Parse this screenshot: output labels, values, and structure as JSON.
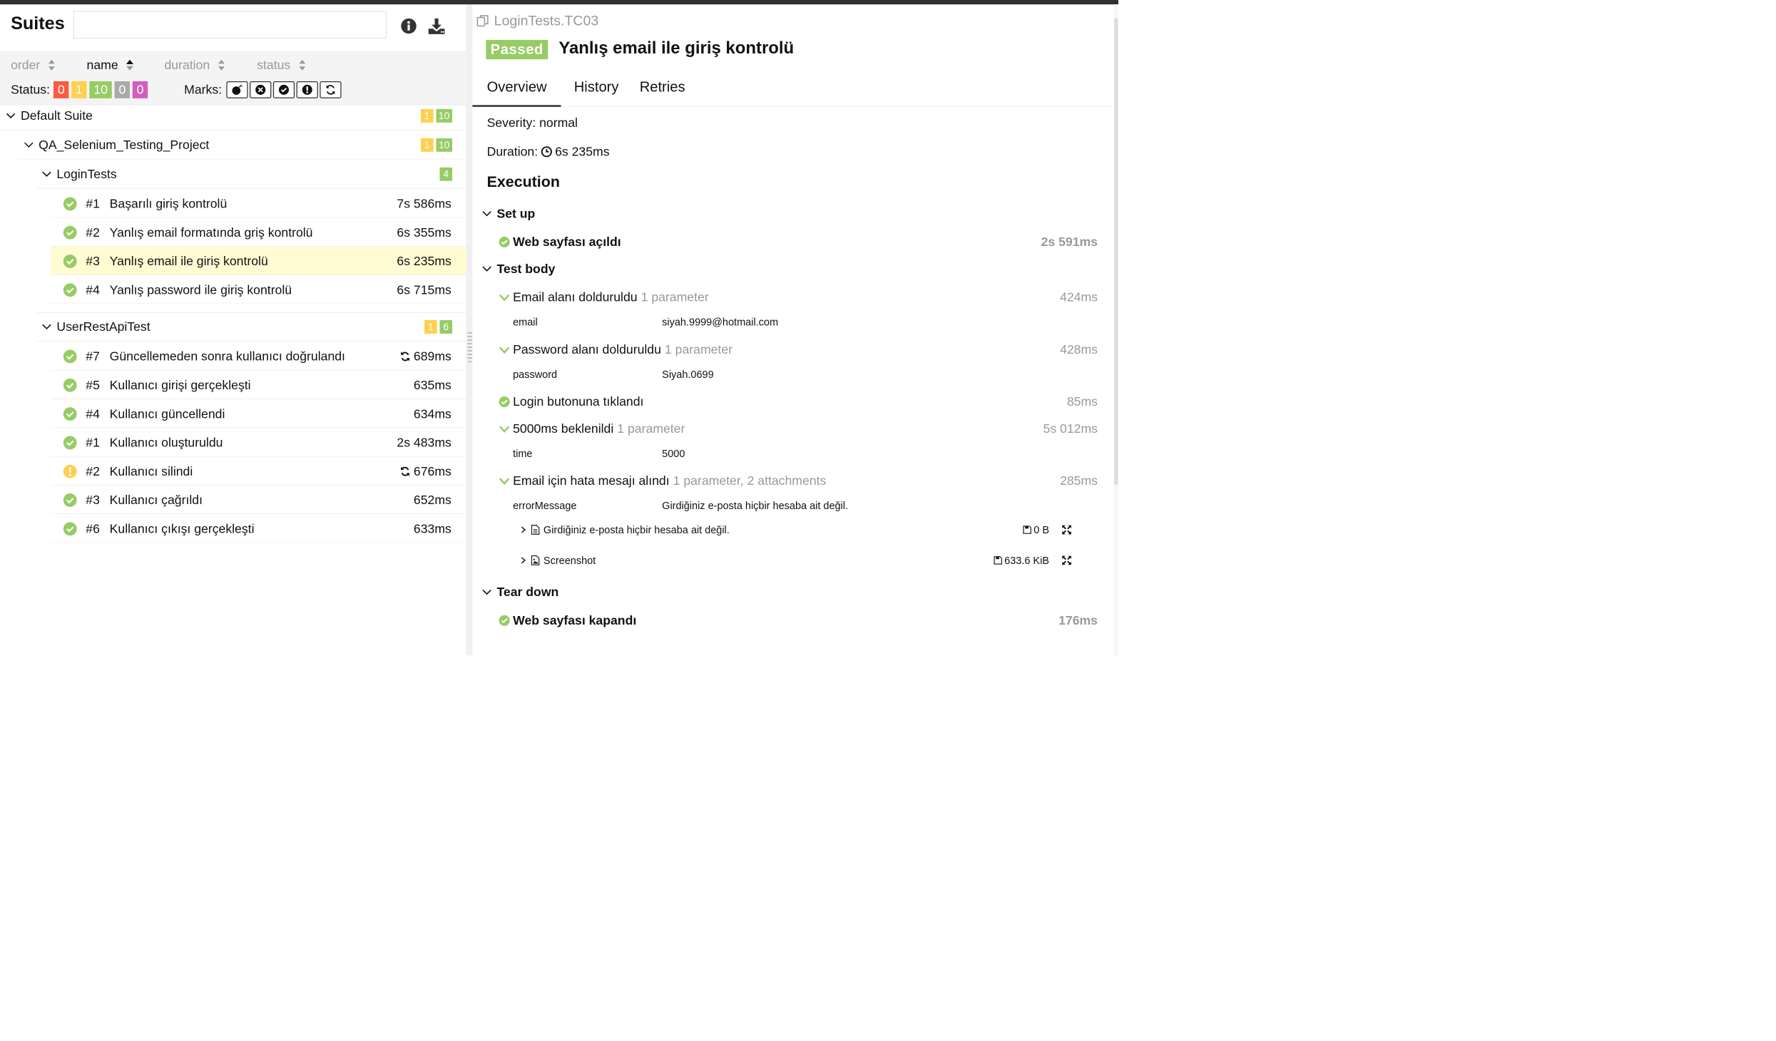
{
  "colors": {
    "failed": "#fd5a3e",
    "broken": "#ffd050",
    "passed": "#97cc64",
    "skipped": "#aaaaaa",
    "unknown": "#d35ebe",
    "selected": "#fffbd3"
  },
  "left": {
    "title": "Suites",
    "search": {
      "value": "",
      "placeholder": ""
    },
    "icons": [
      "info-icon",
      "download-icon"
    ],
    "sort": [
      {
        "label": "order"
      },
      {
        "label": "name"
      },
      {
        "label": "duration"
      },
      {
        "label": "status"
      }
    ],
    "status": {
      "label": "Status:",
      "counts": [
        "0",
        "1",
        "10",
        "0",
        "0"
      ]
    },
    "marks": {
      "label": "Marks:",
      "icons": [
        "flaky-bomb-icon",
        "new-failed-icon",
        "new-passed-icon",
        "new-broken-icon",
        "retries-icon"
      ]
    },
    "tree": {
      "default_suite": {
        "name": "Default Suite",
        "counts": [
          "1",
          "10"
        ]
      },
      "project": {
        "name": "QA_Selenium_Testing_Project",
        "counts": [
          "1",
          "10"
        ]
      },
      "login": {
        "name": "LoginTests",
        "counts": [
          "4"
        ],
        "tests": [
          {
            "num": "#1",
            "name": "Başarılı giriş kontrolü",
            "dur": "7s 586ms",
            "status": "passed"
          },
          {
            "num": "#2",
            "name": "Yanlış email formatında griş kontrolü",
            "dur": "6s 355ms",
            "status": "passed"
          },
          {
            "num": "#3",
            "name": "Yanlış email ile giriş kontrolü",
            "dur": "6s 235ms",
            "status": "passed"
          },
          {
            "num": "#4",
            "name": "Yanlış password ile giriş kontrolü",
            "dur": "6s 715ms",
            "status": "passed"
          }
        ]
      },
      "api": {
        "name": "UserRestApiTest",
        "counts": [
          "1",
          "6"
        ],
        "tests": [
          {
            "num": "#7",
            "name": "Güncellemeden sonra kullanıcı doğrulandı",
            "dur": "689ms",
            "status": "passed"
          },
          {
            "num": "#5",
            "name": "Kullanıcı girişi gerçekleşti",
            "dur": "635ms",
            "status": "passed"
          },
          {
            "num": "#4",
            "name": "Kullanıcı güncellendi",
            "dur": "634ms",
            "status": "passed"
          },
          {
            "num": "#1",
            "name": "Kullanıcı oluşturuldu",
            "dur": "2s 483ms",
            "status": "passed"
          },
          {
            "num": "#2",
            "name": "Kullanıcı silindi",
            "dur": "676ms",
            "status": "broken"
          },
          {
            "num": "#3",
            "name": "Kullanıcı çağrıldı",
            "dur": "652ms",
            "status": "passed"
          },
          {
            "num": "#6",
            "name": "Kullanıcı çıkışı gerçekleşti",
            "dur": "633ms",
            "status": "passed"
          }
        ]
      }
    }
  },
  "right": {
    "path": "LoginTests.TC03",
    "status": "Passed",
    "title": "Yanlış email ile giriş kontrolü",
    "tabs": [
      {
        "label": "Overview"
      },
      {
        "label": "History"
      },
      {
        "label": "Retries"
      }
    ],
    "severity": "Severity: normal",
    "duration_label": "Duration:",
    "duration": "6s 235ms",
    "execution": "Execution",
    "setup": {
      "label": "Set up",
      "step": {
        "name": "Web sayfası açıldı",
        "dur": "2s 591ms"
      }
    },
    "body": {
      "label": "Test body",
      "steps": [
        {
          "name": "Email alanı dolduruldu",
          "params": "1 parameter",
          "dur": "424ms",
          "pname": "email",
          "pval": "siyah.9999@hotmail.com"
        },
        {
          "name": "Password alanı dolduruldu",
          "params": "1 parameter",
          "dur": "428ms",
          "pname": "password",
          "pval": "Siyah.0699"
        },
        {
          "name": "Login butonuna tıklandı",
          "dur": "85ms"
        },
        {
          "name": "5000ms beklenildi",
          "params": "1 parameter",
          "dur": "5s 012ms",
          "pname": "time",
          "pval": "5000"
        },
        {
          "name": "Email için hata mesajı alındı",
          "params": "1 parameter, 2 attachments",
          "dur": "285ms",
          "pname": "errorMessage",
          "pval": "Girdiğiniz e-posta hiçbir hesaba ait değil."
        }
      ],
      "attachments": [
        {
          "name": "Girdiğiniz e-posta hiçbir hesaba ait değil.",
          "size": "0 B"
        },
        {
          "name": "Screenshot",
          "size": "633.6 KiB"
        }
      ]
    },
    "teardown": {
      "label": "Tear down",
      "step": {
        "name": "Web sayfası kapandı",
        "dur": "176ms"
      }
    }
  }
}
